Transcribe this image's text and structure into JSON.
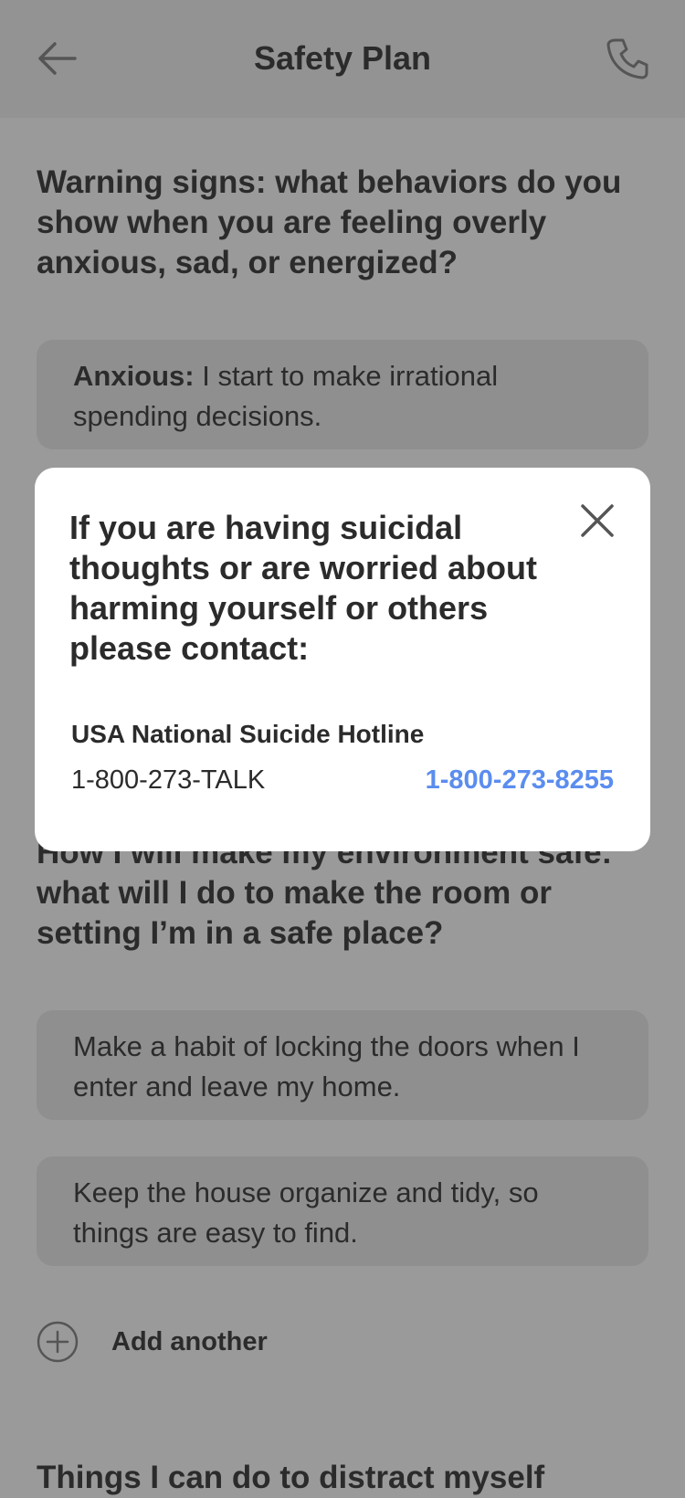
{
  "header": {
    "title": "Safety Plan",
    "back_icon": "arrow-left-icon",
    "call_icon": "phone-icon"
  },
  "sections": {
    "warning": {
      "question": "Warning signs: what behaviors do you show when you are feeling overly anxious, sad, or energized?",
      "cards": [
        {
          "label": "Anxious:",
          "text": " I start to make irrational spending decisions."
        }
      ]
    },
    "environment": {
      "question": "How I will make my environment safe: what will I do to make the room or setting I’m in a safe place?",
      "cards": [
        {
          "text": "Make a habit of locking the doors when I enter and leave my home."
        },
        {
          "text": "Keep the house organize and tidy, so things are easy to find."
        }
      ],
      "add_label": "Add another"
    },
    "distract": {
      "question": "Things I can do to distract myself"
    }
  },
  "modal": {
    "title": "If you are having suicidal thoughts or are worried about harming yourself or others please contact:",
    "hotline_name": "USA National Suicide Hotline",
    "hotline_alt": "1-800-273-TALK",
    "hotline_number": "1-800-273-8255",
    "link_color": "#5b8def"
  },
  "colors": {
    "overlay_background": "#9a9a9a",
    "header_background": "#939393",
    "card_background": "#8f8f8f",
    "text": "#2b2b2b"
  }
}
